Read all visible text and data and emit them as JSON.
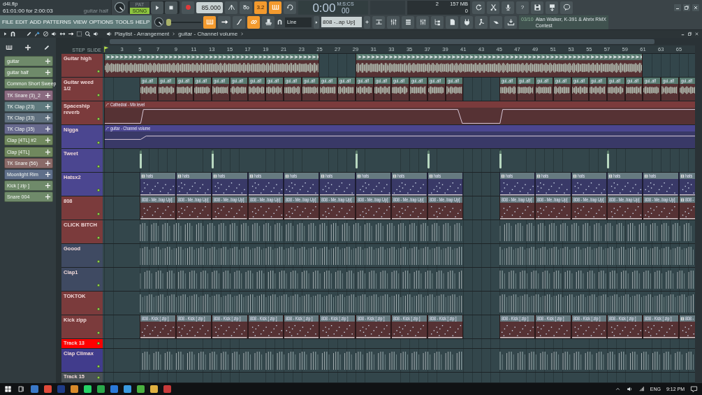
{
  "title_panel": {
    "file": "d4l.flp",
    "position": "61:01:00 for 2:00:03",
    "hint": "guitar half"
  },
  "menu": [
    "FILE",
    "EDIT",
    "ADD",
    "PATTERNS",
    "VIEW",
    "OPTIONS",
    "TOOLS",
    "HELP"
  ],
  "transport": {
    "modes": [
      {
        "label": "PAT",
        "selected": false
      },
      {
        "label": "SONG",
        "selected": true
      }
    ],
    "tempo": "85.000"
  },
  "tools_row1": [
    {
      "on": false
    },
    {
      "on": false
    },
    {
      "on": true,
      "label": "3.2"
    },
    {
      "on": true
    },
    {
      "on": false
    }
  ],
  "time": {
    "units": "M:S:CS",
    "main": "0:00",
    "fraction": "00"
  },
  "monitor": {
    "cpu": "2",
    "memory": "157 MB",
    "polyphony": "0"
  },
  "help": "?",
  "master_pitch": {
    "level": 0
  },
  "tools_row2": [
    {
      "on": true
    },
    {
      "on": false
    },
    {
      "on": false
    },
    {
      "on": true
    },
    {
      "on": false
    }
  ],
  "snap": "Line",
  "pattern": "808 -..ap Up]",
  "news": {
    "date": "03/10",
    "title": "Alan Walker, K-391 & Ahrix RMX Contest"
  },
  "playlist": {
    "breadcrumb": [
      "Playlist - Arrangement",
      "guitar - Channel volume"
    ],
    "step": "STEP",
    "slide": "SLIDE",
    "ruler": [
      "3",
      "5",
      "7",
      "9",
      "11",
      "13",
      "15",
      "17",
      "19",
      "21",
      "23",
      "25",
      "27",
      "29",
      "31",
      "33",
      "35",
      "37",
      "39",
      "41",
      "43",
      "45",
      "47",
      "49",
      "51",
      "53",
      "55",
      "57",
      "59",
      "61",
      "63",
      "65"
    ]
  },
  "channels": [
    {
      "name": "guitar",
      "color": "#6f8a6a"
    },
    {
      "name": "guitar half",
      "color": "#6f8a6a"
    },
    {
      "name": "Common Short Sweep",
      "color": "#6f8a6a"
    },
    {
      "name": "TK Snare (3)_2",
      "color": "#8a6a80"
    },
    {
      "name": "TK Clap (23)",
      "color": "#5f7a7e"
    },
    {
      "name": "TK Clap (33)",
      "color": "#60707e"
    },
    {
      "name": "TK Clap (35)",
      "color": "#686a8e"
    },
    {
      "name": "Clap [4TL] #2",
      "color": "#70885e"
    },
    {
      "name": "Clap [4TL]",
      "color": "#70885e"
    },
    {
      "name": "TK Snare (56)",
      "color": "#8a6a68"
    },
    {
      "name": "Moonlight Rim",
      "color": "#5f6f8a"
    },
    {
      "name": "Kick [ zip ]",
      "color": "#6f8a6a"
    },
    {
      "name": "Snare 004",
      "color": "#6f8a6a"
    }
  ],
  "tracks": [
    {
      "name": "Guitar high",
      "color": "#7b3b3c",
      "kind": "audio"
    },
    {
      "name": "Guitar weed 1/2",
      "color": "#7b3b3c",
      "kind": "audio",
      "clips": [
        "gui..alf",
        "gui..alf",
        "gui..alf",
        "gui..alf",
        "gui..alf",
        "gui..alf",
        "gui..alf",
        "gui..alf",
        "gui..alf",
        "gui..alf",
        "gui..alf",
        "gui..alf",
        "gui..alf",
        "gui..alf",
        "gui..alf",
        "gui..alf",
        "gui..alf",
        "gui..alf",
        "gui..alf",
        "gui..alf",
        "gui..alf",
        "gui..alf",
        "gui..alf",
        "gui..alf",
        "gui..alf",
        "gui..alf",
        "gui..alf",
        "gui..alf",
        "gui..alf"
      ]
    },
    {
      "name": "Spaceship reverb",
      "color": "#7b3b3c",
      "kind": "automation",
      "clips": [
        "Cathedral - Mix level"
      ]
    },
    {
      "name": "Nigga",
      "color": "#4b4690",
      "kind": "automation",
      "clips": [
        "guitar - Channel volume"
      ]
    },
    {
      "name": "Tweet",
      "color": "#4b4690",
      "kind": "blips"
    },
    {
      "name": "Hatsx2",
      "color": "#4b4690",
      "kind": "pattern",
      "clips": [
        "hats",
        "hats",
        "hats",
        "hats",
        "hats",
        "hats",
        "hats",
        "hats",
        "hats",
        "hats",
        "hats",
        "hats",
        "hats",
        "hats",
        "hats"
      ]
    },
    {
      "name": "808",
      "color": "#7b3b3c",
      "kind": "pattern",
      "clips": [
        "808 - Me..trap Up]",
        "808 - Me..trap Up]",
        "808 - Me..trap Up]",
        "808 - Me..trap Up]",
        "808 - Me..trap Up]",
        "808 - Me..trap Up]",
        "808 - Me..trap Up]",
        "808 - Me..trap Up]",
        "808 - Me..trap Up]",
        "808 - Me..trap Up]",
        "808 - Me..trap Up]",
        "808 - Me..trap Up]",
        "808 - Me..trap Up]",
        "808 - Me..trap Up]",
        "808 -"
      ]
    },
    {
      "name": "CLICK BITCH",
      "color": "#7b3b3c",
      "kind": "notes"
    },
    {
      "name": "Goood",
      "color": "#3f4a62",
      "kind": "notes"
    },
    {
      "name": "Clap1",
      "color": "#3f4a62",
      "kind": "notes"
    },
    {
      "name": "TOKTOK",
      "color": "#7b3b3c",
      "kind": "notes"
    },
    {
      "name": "Kick zipp",
      "color": "#7b3b3c",
      "kind": "pattern",
      "clips": [
        "808 - Kick [ zip ]",
        "808 - Kick [ zip ]",
        "808 - Kick [ zip ]",
        "808 - Kick [ zip ]",
        "808 - Kick [ zip ]",
        "808 - Kick [ zip ]",
        "808 - Kick [ zip ]",
        "808 - Kick [ zip ]",
        "808 - Kick [ zip ]",
        "808 - Kick [ zip ]",
        "808 - Kick [ zip ]",
        "808 - Kick [ zip ]",
        "808 - Kick [ zip ]",
        "808 - Kick [ zip ]",
        "808 -"
      ]
    },
    {
      "name": "Track 13",
      "color": "#ff0000",
      "kind": "empty"
    },
    {
      "name": "Clap Climax",
      "color": "#413c8c",
      "kind": "notes"
    },
    {
      "name": "Track 15",
      "color": "#4a5256",
      "kind": "empty"
    }
  ],
  "taskbar": {
    "language": "ENG",
    "time": "9:12 PM"
  }
}
